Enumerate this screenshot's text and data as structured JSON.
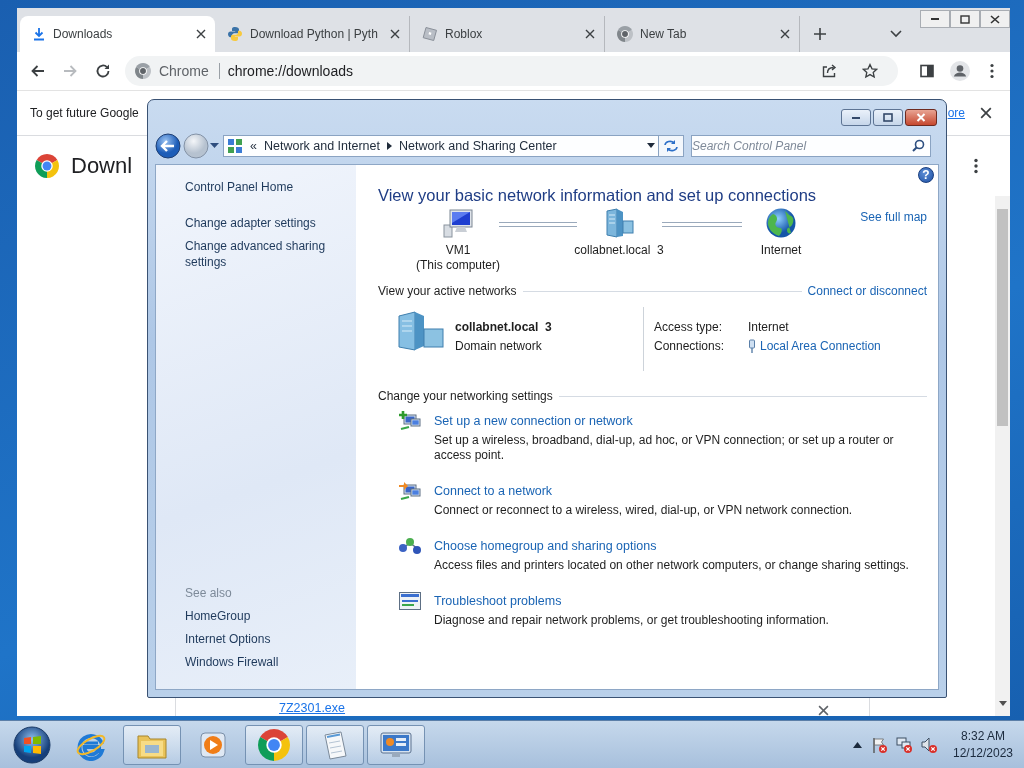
{
  "browser": {
    "tabs": [
      {
        "kind": "download",
        "title": "Downloads",
        "selected": true
      },
      {
        "kind": "python",
        "title": "Download Python | Pyth",
        "selected": false
      },
      {
        "kind": "roblox",
        "title": "Roblox",
        "selected": false
      },
      {
        "kind": "chrome",
        "title": "New Tab",
        "selected": false
      }
    ],
    "toolbar": {
      "forward_disabled": true,
      "site_chip": "Chrome",
      "url": "chrome://downloads"
    },
    "infobar": {
      "text": "To get future Google",
      "link": "ore"
    },
    "page": {
      "title": "Downl",
      "download": {
        "file_link": "7Z2301.exe"
      }
    }
  },
  "control_panel": {
    "breadcrumb": {
      "overflow": "«",
      "items": [
        "Network and Internet",
        "Network and Sharing Center"
      ]
    },
    "search": {
      "placeholder": "Search Control Panel"
    },
    "sidebar": {
      "links": [
        "Control Panel Home",
        "Change adapter settings",
        "Change advanced sharing settings"
      ],
      "see_also_title": "See also",
      "see_also": [
        "HomeGroup",
        "Internet Options",
        "Windows Firewall"
      ]
    },
    "help": "?",
    "heading": "View your basic network information and set up connections",
    "map": {
      "nodes": [
        {
          "kind": "computer",
          "name": "VM1",
          "subtitle": "(This computer)"
        },
        {
          "kind": "domain",
          "name": "collabnet.local  3"
        },
        {
          "kind": "internet",
          "name": "Internet"
        }
      ],
      "full_map_link": "See full map"
    },
    "active_networks": {
      "title": "View your active networks",
      "action_link": "Connect or disconnect",
      "network": {
        "name": "collabnet.local  3",
        "category": "Domain network"
      },
      "access_type_label": "Access type:",
      "access_type": "Internet",
      "connections_label": "Connections:",
      "connection_link": "Local Area Connection"
    },
    "settings": {
      "title": "Change your networking settings",
      "tasks": [
        {
          "kind": "new_connection",
          "link": "Set up a new connection or network",
          "description": "Set up a wireless, broadband, dial-up, ad hoc, or VPN connection; or set up a router or access point."
        },
        {
          "kind": "connect",
          "link": "Connect to a network",
          "description": "Connect or reconnect to a wireless, wired, dial-up, or VPN network connection."
        },
        {
          "kind": "homegroup",
          "link": "Choose homegroup and sharing options",
          "description": "Access files and printers located on other network computers, or change sharing settings."
        },
        {
          "kind": "troubleshoot",
          "link": "Troubleshoot problems",
          "description": "Diagnose and repair network problems, or get troubleshooting information."
        }
      ]
    }
  },
  "taskbar": {
    "apps": [
      {
        "kind": "ie",
        "running": false
      },
      {
        "kind": "explorer",
        "running": true
      },
      {
        "kind": "media",
        "running": false
      },
      {
        "kind": "chrome",
        "running": true
      },
      {
        "kind": "notepad",
        "running": true
      },
      {
        "kind": "control_panel",
        "running": true
      }
    ],
    "clock": {
      "time": "8:32 AM",
      "date": "12/12/2023"
    }
  }
}
